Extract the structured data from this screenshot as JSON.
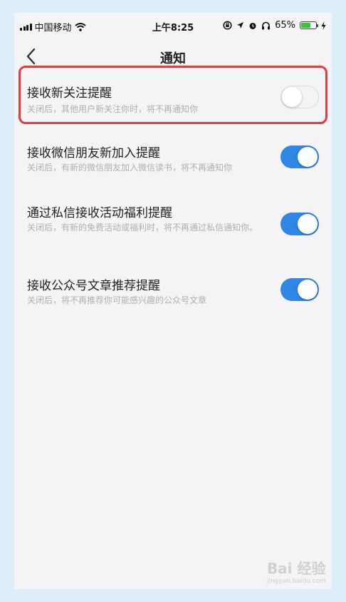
{
  "status_bar": {
    "carrier": "中国移动",
    "time": "上午8:25",
    "battery_percent": "65%",
    "battery_level": 0.65,
    "icons": [
      "signal-icon",
      "wifi-icon",
      "lock-rotation-icon",
      "location-icon",
      "alarm-icon",
      "headphones-icon",
      "battery-icon",
      "charging-icon"
    ]
  },
  "nav": {
    "title": "通知",
    "back_icon": "chevron-left-icon"
  },
  "settings": [
    {
      "title": "接收新关注提醒",
      "desc": "关闭后，其他用户新关注你时，将不再通知你",
      "enabled": false
    },
    {
      "title": "接收微信朋友新加入提醒",
      "desc": "关闭后，有新的微信朋友加入微信读书，将不再通知你",
      "enabled": true
    },
    {
      "title": "通过私信接收活动福利提醒",
      "desc": "关闭后，有新的免费活动或福利时，将不再通过私信通知你。",
      "enabled": true
    },
    {
      "title": "接收公众号文章推荐提醒",
      "desc": "关闭后，将不再推荐你可能感兴趣的公众号文章",
      "enabled": true
    }
  ],
  "colors": {
    "toggle_on": "#2f86e5",
    "highlight": "#e23c3c",
    "background": "#dbeefa"
  },
  "watermark": {
    "text": "Bai 经验",
    "sub": "jingyan.baidu.com"
  }
}
